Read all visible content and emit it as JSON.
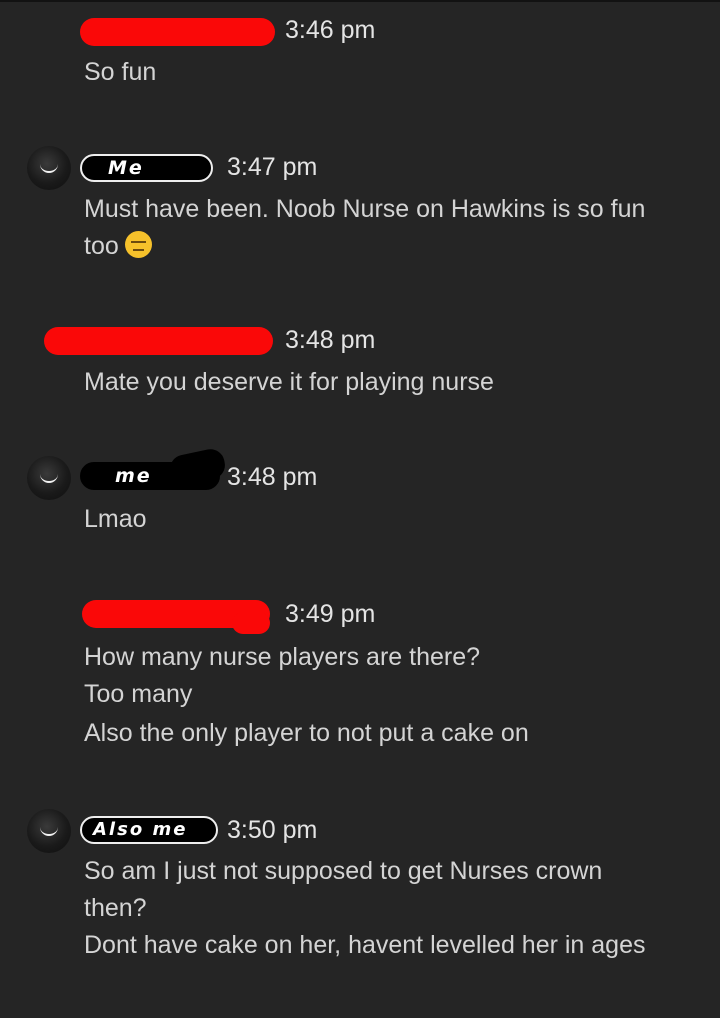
{
  "messages": [
    {
      "sender": "redacted",
      "time": "3:46 pm",
      "lines": [
        "So fun"
      ]
    },
    {
      "sender": "Me",
      "time": "3:47 pm",
      "lines": [
        "Must have been. Noob Nurse on Hawkins is so fun",
        "too"
      ],
      "emoji": "expressionless-face-icon"
    },
    {
      "sender": "redacted",
      "time": "3:48 pm",
      "lines": [
        "Mate you deserve it for playing nurse"
      ]
    },
    {
      "sender": "me",
      "time": "3:48 pm",
      "lines": [
        "Lmao"
      ]
    },
    {
      "sender": "redacted",
      "time": "3:49 pm",
      "lines": [
        "How many nurse players are there?",
        "Too many",
        "Also the only player to not put a cake on"
      ]
    },
    {
      "sender": "Also me",
      "time": "3:50 pm",
      "lines": [
        "So am I just not supposed to get Nurses crown",
        "then?",
        "Dont have cake on her, havent levelled her in ages"
      ]
    }
  ],
  "colors": {
    "background": "#252525",
    "redaction_red": "#fa0808",
    "redaction_black": "#000000",
    "text": "#d4d4d4"
  }
}
